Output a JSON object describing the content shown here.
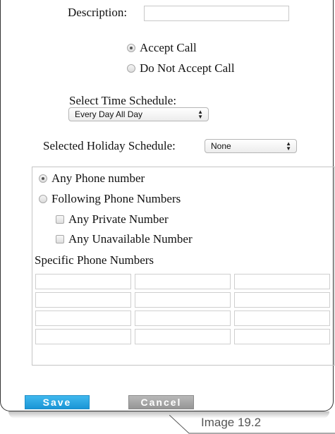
{
  "form": {
    "description_label": "Description:",
    "description_value": "",
    "call_options": [
      {
        "label": "Accept Call",
        "checked": true
      },
      {
        "label": "Do Not Accept Call",
        "checked": false
      }
    ],
    "time_schedule_label": "Select Time Schedule:",
    "time_schedule_value": "Every Day All Day",
    "holiday_schedule_label": "Selected Holiday Schedule:",
    "holiday_schedule_value": "None"
  },
  "numbers": {
    "options": [
      {
        "label": "Any Phone number",
        "checked": true
      },
      {
        "label": "Following Phone Numbers",
        "checked": false
      }
    ],
    "checkboxes": [
      {
        "label": "Any Private Number",
        "checked": false
      },
      {
        "label": "Any Unavailable Number",
        "checked": false
      }
    ],
    "specific_label": "Specific Phone Numbers"
  },
  "buttons": {
    "save_label": "Save",
    "cancel_label": "Cancel"
  },
  "caption": "Image 19.2",
  "colors": {
    "save_button": "#1a95d6",
    "cancel_button": "#969696"
  },
  "icons": {
    "select_arrows": "up-down-arrows-icon"
  }
}
